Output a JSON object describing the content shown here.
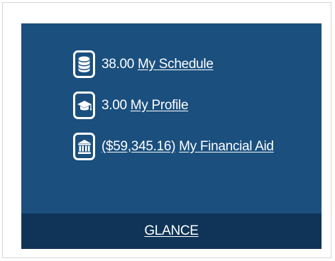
{
  "widget": {
    "rows": [
      {
        "icon": "coins-stack-icon",
        "value": "38.00",
        "link": "My Schedule"
      },
      {
        "icon": "graduation-cap-icon",
        "value": "3.00",
        "link": "My Profile"
      },
      {
        "icon": "bank-building-icon",
        "value": "($59,345.16)",
        "link": "My Financial Aid"
      }
    ],
    "footer_link": "GLANCE"
  },
  "colors": {
    "card_background": "#1a4f7e",
    "footer_background": "#0f3457",
    "text": "#ffffff"
  }
}
